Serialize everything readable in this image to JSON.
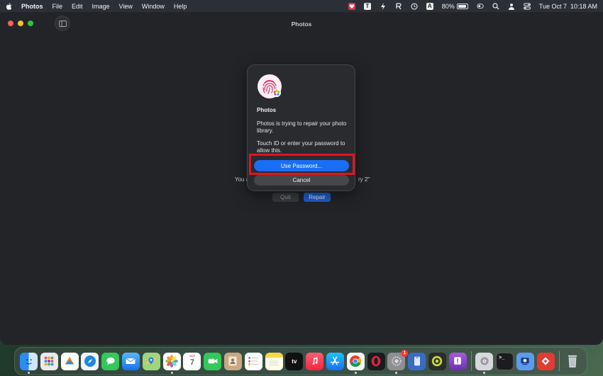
{
  "menubar": {
    "app_name": "Photos",
    "items": [
      "File",
      "Edit",
      "Image",
      "View",
      "Window",
      "Help"
    ],
    "battery_percent": "80%",
    "battery_level": 0.8,
    "datetime": "Tue Oct 7  10:18 AM",
    "icons": [
      "apple-icon",
      "heart-app-icon",
      "text-app-icon",
      "bolt-app-icon",
      "refresh-icon",
      "history-icon",
      "keyboard-input-icon",
      "battery-icon",
      "control-icon",
      "search-icon",
      "user-icon",
      "control-center-icon"
    ],
    "input_letter": "A",
    "text_letter": "T"
  },
  "window": {
    "title": "Photos",
    "bg_text_left": "You a",
    "bg_text_right": "ry 2\"",
    "quit_label": "Quit",
    "repair_label": "Repair"
  },
  "dialog": {
    "title": "Photos",
    "message1": "Photos is trying to repair your photo library.",
    "message2": "Touch ID or enter your password to allow this.",
    "primary_label": "Use Password...",
    "cancel_label": "Cancel",
    "highlight_color": "#e0141f",
    "primary_color": "#1a6ef5"
  },
  "dock": {
    "calendar_day": "7",
    "calendar_month": "OCT",
    "appletv_label": "tv",
    "terminal_label": ">_",
    "notification_count": "1",
    "apps": [
      "finder",
      "launchpad",
      "affinity",
      "safari",
      "messages",
      "mail",
      "maps",
      "photos",
      "calendar",
      "facetime",
      "contacts",
      "reminders",
      "notes",
      "apple-tv",
      "music",
      "app-store",
      "chrome",
      "opera",
      "system-settings",
      "notchmeister",
      "app-green",
      "app-purple",
      "disk-utility",
      "terminal",
      "migration",
      "app-red",
      "trash"
    ]
  }
}
